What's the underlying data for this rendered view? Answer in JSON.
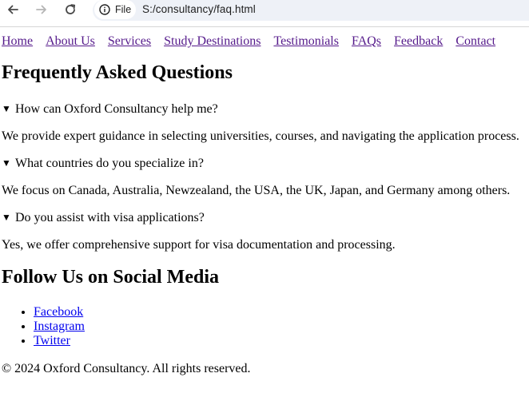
{
  "browser": {
    "site_chip_label": "File",
    "url": "S:/consultancy/faq.html"
  },
  "nav": {
    "links": [
      "Home",
      "About Us",
      "Services",
      "Study Destinations",
      "Testimonials",
      "FAQs",
      "Feedback",
      "Contact"
    ]
  },
  "faq": {
    "title": "Frequently Asked Questions",
    "items": [
      {
        "question": "How can Oxford Consultancy help me?",
        "answer": "We provide expert guidance in selecting universities, courses, and navigating the application process."
      },
      {
        "question": "What countries do you specialize in?",
        "answer": "We focus on Canada, Australia, Newzealand, the USA, the UK, Japan, and Germany among others."
      },
      {
        "question": "Do you assist with visa applications?",
        "answer": "Yes, we offer comprehensive support for visa documentation and processing."
      }
    ],
    "expanded_marker": "▼"
  },
  "social": {
    "title": "Follow Us on Social Media",
    "links": [
      "Facebook",
      "Instagram",
      "Twitter"
    ]
  },
  "footer": {
    "text": "© 2024 Oxford Consultancy. All rights reserved."
  },
  "colors": {
    "visited_link": "#551a8b",
    "link": "#0000ee",
    "omnibox_bg": "#eef1f7"
  },
  "icons": {
    "back": "arrow-left-icon",
    "forward": "arrow-right-icon",
    "reload": "reload-icon",
    "site_info": "info-icon"
  }
}
